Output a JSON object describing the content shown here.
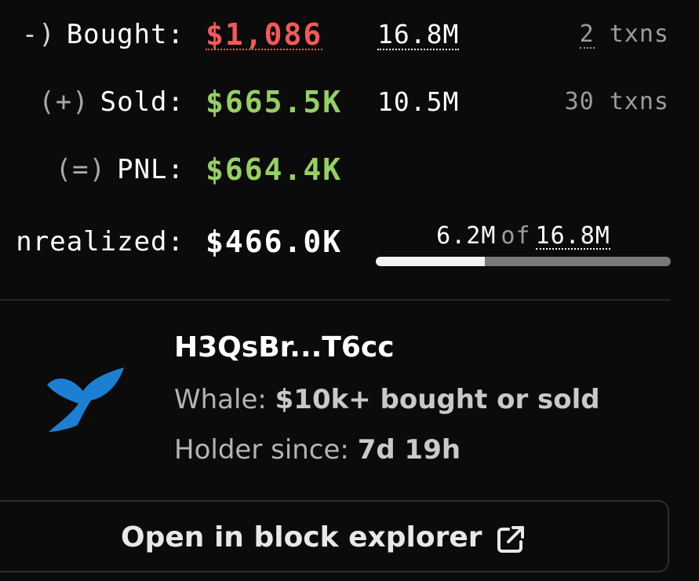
{
  "stats": {
    "bought": {
      "sign": "-)",
      "label": "Bought:",
      "value": "$1,086",
      "amount": "16.8M",
      "txn_count": "2",
      "txn_unit": "txns"
    },
    "sold": {
      "sign": "(+)",
      "label": "Sold:",
      "value": "$665.5K",
      "amount": "10.5M",
      "txn_count": "30",
      "txn_unit": "txns"
    },
    "pnl": {
      "sign": "(=)",
      "label": "PNL:",
      "value": "$664.4K"
    },
    "unrealized": {
      "label": "nrealized:",
      "value": "$466.0K",
      "held": "6.2M",
      "of": "of",
      "total": "16.8M",
      "held_fraction": 0.37
    }
  },
  "wallet": {
    "address": "H3QsBr...T6cc",
    "whale_label": "Whale:",
    "whale_desc": "$10k+ bought or sold",
    "holder_label": "Holder since:",
    "holder_since": "7d 19h",
    "icon": "whale-tail-icon"
  },
  "actions": {
    "explorer_label": "Open in block explorer",
    "explorer_icon": "external-link-icon"
  },
  "colors": {
    "negative": "#f25a5a",
    "positive": "#96cf65",
    "whale": "#1d7fd1"
  }
}
